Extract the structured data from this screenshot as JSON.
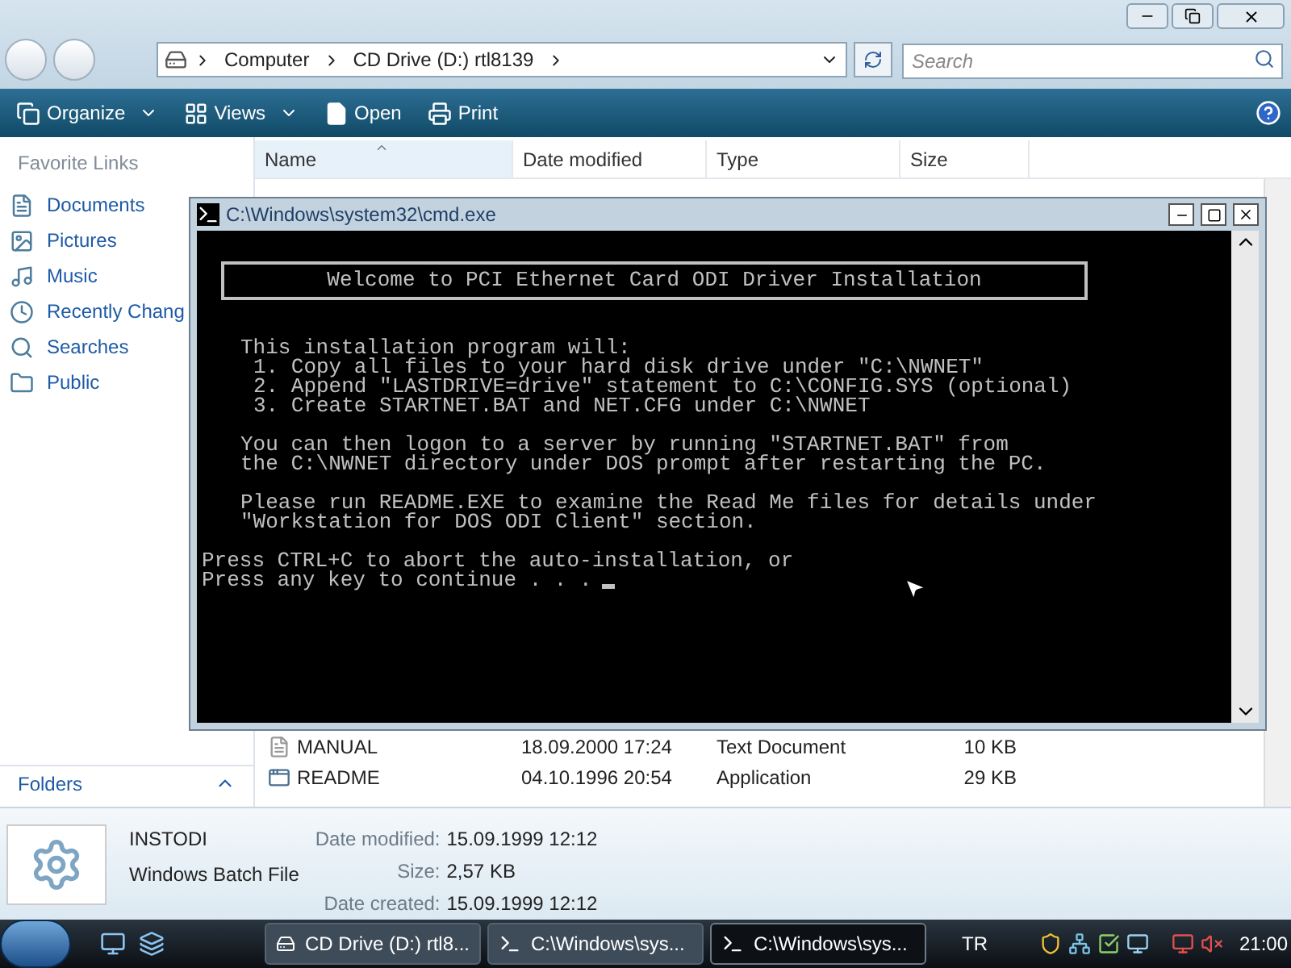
{
  "explorer": {
    "breadcrumbs": [
      "Computer",
      "CD Drive (D:) rtl8139"
    ],
    "search": {
      "placeholder": "Search"
    },
    "toolbar": [
      {
        "label": "Organize",
        "kind": "menu"
      },
      {
        "label": "Views",
        "kind": "menu"
      },
      {
        "label": "Open",
        "kind": "open"
      },
      {
        "label": "Print",
        "kind": "print"
      }
    ],
    "nav": {
      "heading": "Favorite Links",
      "items": [
        {
          "label": "Documents",
          "kind": "documents"
        },
        {
          "label": "Pictures",
          "kind": "pictures"
        },
        {
          "label": "Music",
          "kind": "music"
        },
        {
          "label": "Recently Chang",
          "kind": "recent"
        },
        {
          "label": "Searches",
          "kind": "searches"
        },
        {
          "label": "Public",
          "kind": "public"
        }
      ],
      "folders": "Folders"
    },
    "columns": [
      {
        "label": "Name",
        "sorted": true
      },
      {
        "label": "Date modified",
        "sorted": false
      },
      {
        "label": "Type",
        "sorted": false
      },
      {
        "label": "Size",
        "sorted": false
      }
    ],
    "rows": [
      {
        "name": "MANUAL",
        "kind": "text",
        "date": "18.09.2000 17:24",
        "type": "Text Document",
        "size": "10 KB"
      },
      {
        "name": "README",
        "kind": "app",
        "date": "04.10.1996 20:54",
        "type": "Application",
        "size": "29 KB"
      }
    ],
    "details": {
      "name": "INSTODI",
      "type": "Windows Batch File",
      "props": [
        {
          "label": "Date modified:",
          "value": "15.09.1999 12:12"
        },
        {
          "label": "Size:",
          "value": "2,57 KB"
        },
        {
          "label": "Date created:",
          "value": "15.09.1999 12:12"
        }
      ]
    }
  },
  "console": {
    "title": "C:\\Windows\\system32\\cmd.exe",
    "banner": "Welcome to PCI Ethernet Card ODI Driver Installation",
    "blocks": [
      {
        "kind": "text",
        "lines": [
          "This installation program will:"
        ]
      },
      {
        "kind": "list",
        "lines": [
          "1. Copy all files to your hard disk drive under \"C:\\NWNET\"",
          "2. Append \"LASTDRIVE=drive\" statement to C:\\CONFIG.SYS (optional)",
          "3. Create STARTNET.BAT and NET.CFG under C:\\NWNET"
        ]
      },
      {
        "kind": "text",
        "lines": [
          "You can then logon to a server by running \"STARTNET.BAT\" from",
          "the C:\\NWNET directory under DOS prompt after restarting the PC."
        ]
      },
      {
        "kind": "text",
        "lines": [
          "Please run README.EXE to examine the Read Me files for details under",
          "\"Workstation for DOS ODI Client\" section."
        ]
      },
      {
        "kind": "prompt",
        "lines": [
          "Press CTRL+C to abort the auto-installation, or",
          "Press any key to continue . . ."
        ]
      }
    ]
  },
  "taskbar": {
    "tasks": [
      {
        "label": "CD Drive (D:) rtl8...",
        "kind": "drive",
        "selected": false
      },
      {
        "label": "C:\\Windows\\sys...",
        "kind": "console",
        "selected": false
      },
      {
        "label": "C:\\Windows\\sys...",
        "kind": "console",
        "selected": true
      }
    ],
    "language": "TR",
    "clock": "21:00"
  }
}
